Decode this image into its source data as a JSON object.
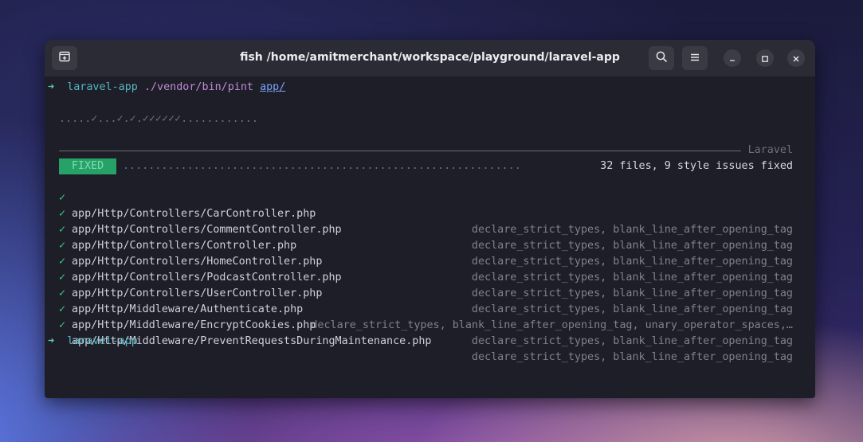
{
  "window": {
    "title": "fish /home/amitmerchant/workspace/playground/laravel-app"
  },
  "icons": {
    "new_tab": "new-tab-icon",
    "search": "search-icon",
    "menu": "hamburger-menu-icon",
    "minimize": "minimize-icon",
    "maximize": "maximize-icon",
    "close": "close-icon"
  },
  "colors": {
    "accent_green": "#26a269",
    "prompt_cyan": "#56b6c2",
    "terminal_bg": "#1e1e28"
  },
  "terminal": {
    "prompt_arrow": "➜",
    "prompt_dir": "laravel-app",
    "command": "./vendor/bin/pint",
    "command_arg": "app/",
    "progress": ".....✓...✓.✓.✓✓✓✓✓✓............",
    "rule_label": "Laravel",
    "badge": "FIXED",
    "summary_dots": "..............................................................",
    "summary": "32 files, 9 style issues fixed",
    "check": "✓",
    "rows": [
      {
        "path": "app/Http/Controllers/CarController.php",
        "issues": "declare_strict_types, blank_line_after_opening_tag"
      },
      {
        "path": "app/Http/Controllers/CommentController.php",
        "issues": "declare_strict_types, blank_line_after_opening_tag"
      },
      {
        "path": "app/Http/Controllers/Controller.php",
        "issues": "declare_strict_types, blank_line_after_opening_tag"
      },
      {
        "path": "app/Http/Controllers/HomeController.php",
        "issues": "declare_strict_types, blank_line_after_opening_tag"
      },
      {
        "path": "app/Http/Controllers/PodcastController.php",
        "issues": "declare_strict_types, blank_line_after_opening_tag"
      },
      {
        "path": "app/Http/Controllers/UserController.php",
        "issues": "declare_strict_types, blank_line_after_opening_tag"
      },
      {
        "path": "app/Http/Middleware/Authenticate.php",
        "issues": "declare_strict_types, blank_line_after_opening_tag, unary_operator_spaces,…"
      },
      {
        "path": "app/Http/Middleware/EncryptCookies.php",
        "issues": "declare_strict_types, blank_line_after_opening_tag"
      },
      {
        "path": "app/Http/Middleware/PreventRequestsDuringMaintenance.php",
        "issues": "declare_strict_types, blank_line_after_opening_tag"
      }
    ],
    "final_prompt_arrow": "➜",
    "final_prompt_dir": "laravel-app"
  }
}
